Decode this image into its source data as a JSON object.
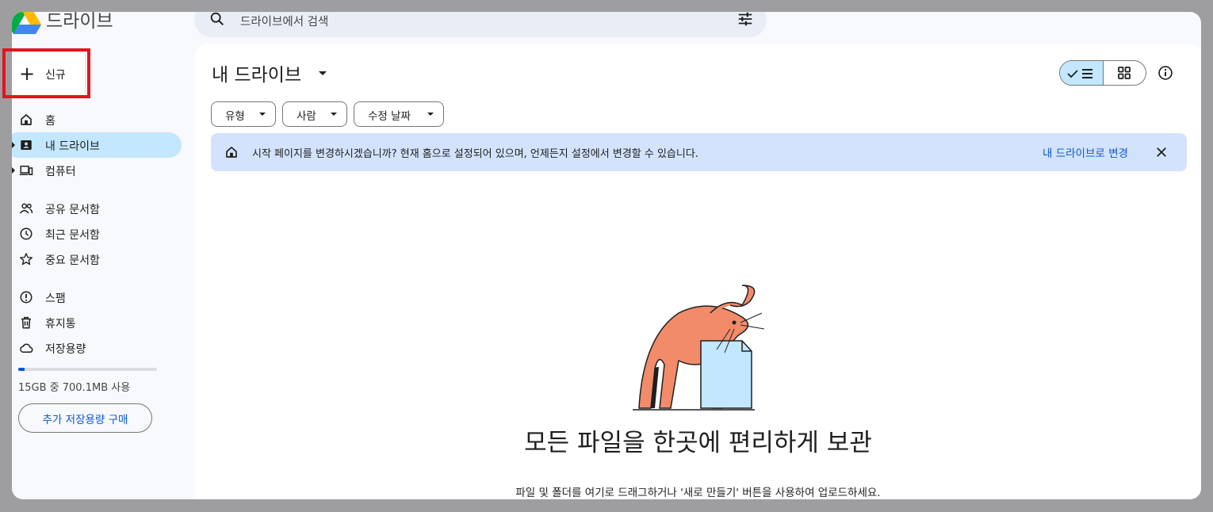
{
  "brand": {
    "name": "드라이브"
  },
  "search": {
    "placeholder": "드라이브에서 검색"
  },
  "new_button": {
    "label": "신규"
  },
  "sidebar": {
    "items": [
      {
        "label": "홈",
        "icon": "home-icon"
      },
      {
        "label": "내 드라이브",
        "icon": "my-drive-icon",
        "active": true,
        "expandable": true
      },
      {
        "label": "컴퓨터",
        "icon": "computer-icon",
        "expandable": true
      },
      {
        "label": "공유 문서함",
        "icon": "shared-icon"
      },
      {
        "label": "최근 문서함",
        "icon": "clock-icon"
      },
      {
        "label": "중요 문서함",
        "icon": "star-icon"
      },
      {
        "label": "스팸",
        "icon": "spam-icon"
      },
      {
        "label": "휴지통",
        "icon": "trash-icon"
      },
      {
        "label": "저장용량",
        "icon": "cloud-icon"
      }
    ]
  },
  "storage": {
    "text": "15GB 중 700.1MB 사용",
    "used_fraction": 0.047,
    "buy_label": "추가 저장용량 구매"
  },
  "main": {
    "title": "내 드라이브",
    "filters": [
      "유형",
      "사람",
      "수정 날짜"
    ],
    "banner": {
      "text": "시작 페이지를 변경하시겠습니까? 현재 홈으로 설정되어 있으며, 언제든지 설정에서 변경할 수 있습니다.",
      "link": "내 드라이브로 변경"
    },
    "empty_title": "모든 파일을 한곳에 편리하게 보관",
    "empty_subtitle": "파일 및 폴더를 여기로 드래그하거나 '새로 만들기' 버튼을 사용하여 업로드하세요."
  },
  "colors": {
    "accent": "#0b57d0",
    "active_bg": "#c2e7ff",
    "banner_bg": "#d3e3fd",
    "highlight": "#e4141e"
  }
}
